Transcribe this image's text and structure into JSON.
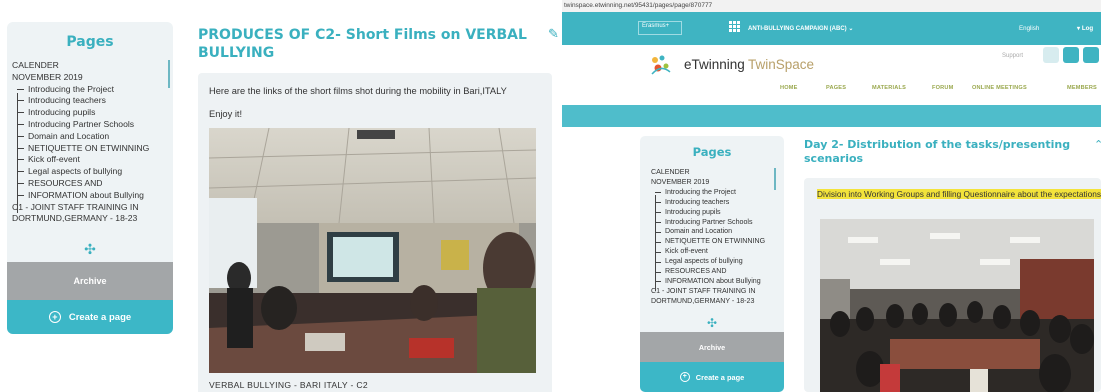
{
  "left": {
    "sidebar": {
      "title": "Pages",
      "items": [
        {
          "label": "CALENDER",
          "sub": false
        },
        {
          "label": "NOVEMBER 2019",
          "sub": false
        },
        {
          "label": "Introducing the Project",
          "sub": true
        },
        {
          "label": "Introducing teachers",
          "sub": true
        },
        {
          "label": "Introducing pupils",
          "sub": true
        },
        {
          "label": "Introducing Partner Schools",
          "sub": true
        },
        {
          "label": "Domain and Location",
          "sub": true
        },
        {
          "label": "NETIQUETTE ON ETWINNING",
          "sub": true
        },
        {
          "label": "Kick off-event",
          "sub": true
        },
        {
          "label": "Legal aspects of bullying",
          "sub": true
        },
        {
          "label": "RESOURCES AND",
          "sub": true
        },
        {
          "label": "INFORMATION about Bullying",
          "sub": true
        },
        {
          "label": "C1 - JOINT STAFF TRAINING IN",
          "sub": false
        },
        {
          "label": "DORTMUND,GERMANY - 18-23",
          "sub": false
        }
      ],
      "archive_label": "Archive",
      "create_label": "Create a page"
    },
    "page_title": "PRODUCES OF C2- Short Films on VERBAL BULLYING",
    "body_text_1": "Here are the links of the short films shot during the mobility in Bari,ITALY",
    "body_text_2": "Enjoy it!",
    "caption": "VERBAL BULLYING - BARI ITALY - C2"
  },
  "right": {
    "url": "twinspace.etwinning.net/95431/pages/page/870777",
    "topbar": {
      "erasmus_label": "Erasmus+",
      "campaign_label": "ANTI-BULLYING CAMPAIGN (ABC)",
      "language": "English",
      "login_label": "Log"
    },
    "logo": {
      "brand1": "eTwinning",
      "brand2": "TwinSpace"
    },
    "support_label": "Support",
    "nav": [
      "HOME",
      "PAGES",
      "MATERIALS",
      "FORUM",
      "ONLINE MEETINGS",
      "MEMBERS"
    ],
    "sidebar": {
      "title": "Pages",
      "items": [
        {
          "label": "CALENDER",
          "sub": false
        },
        {
          "label": "NOVEMBER 2019",
          "sub": false
        },
        {
          "label": "Introducing the Project",
          "sub": true
        },
        {
          "label": "Introducing teachers",
          "sub": true
        },
        {
          "label": "Introducing pupils",
          "sub": true
        },
        {
          "label": "Introducing Partner Schools",
          "sub": true
        },
        {
          "label": "Domain and Location",
          "sub": true
        },
        {
          "label": "NETIQUETTE ON ETWINNING",
          "sub": true
        },
        {
          "label": "Kick off-event",
          "sub": true
        },
        {
          "label": "Legal aspects of bullying",
          "sub": true
        },
        {
          "label": "RESOURCES AND",
          "sub": true
        },
        {
          "label": "INFORMATION about Bullying",
          "sub": true
        },
        {
          "label": "C1 - JOINT STAFF TRAINING IN",
          "sub": false
        },
        {
          "label": "DORTMUND,GERMANY - 18-23",
          "sub": false
        }
      ],
      "archive_label": "Archive",
      "create_label": "Create a page"
    },
    "page_title": "Day 2- Distribution of the tasks/presenting scenarios",
    "highlight_text": "Division into Working Groups and filling Questionnaire about the expectations"
  },
  "colors": {
    "accent": "#3ab0bf",
    "archive_bg": "#a3a6a8",
    "create_bg": "#3cb7c7",
    "highlight": "#f3e33b",
    "nav_text": "#9aa84e"
  }
}
